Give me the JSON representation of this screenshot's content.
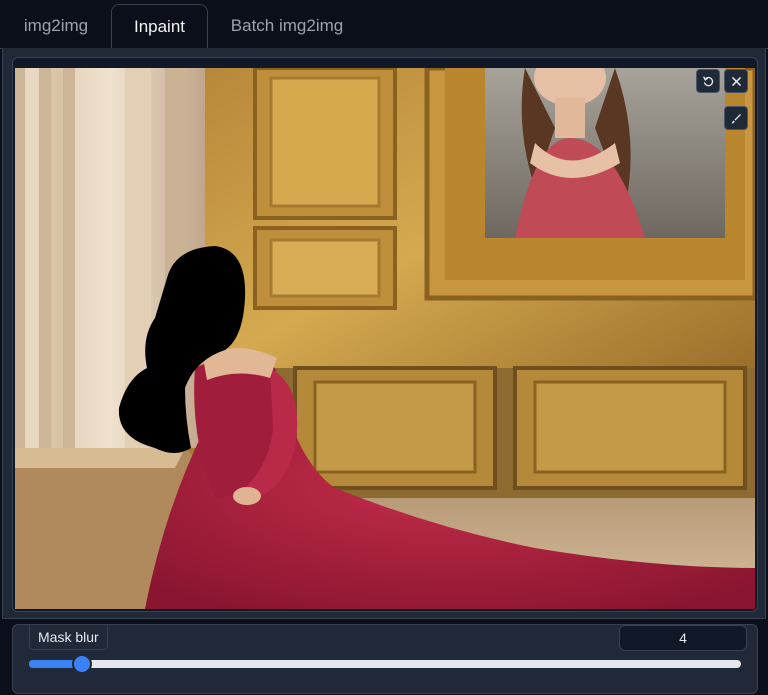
{
  "tabs": [
    {
      "label": "img2img",
      "active": false
    },
    {
      "label": "Inpaint",
      "active": true
    },
    {
      "label": "Batch img2img",
      "active": false
    }
  ],
  "canvas": {
    "icons": [
      "undo-icon",
      "close-icon",
      "brush-icon"
    ]
  },
  "mask_blur": {
    "label": "Mask blur",
    "value": "4",
    "min": 0,
    "max": 64,
    "fill_fraction": 0.074
  },
  "colors": {
    "background": "#0b0f19",
    "panel": "#1f2937",
    "border": "#374151",
    "accent": "#3b82f6",
    "dress": "#b3223f",
    "gold": "#c9a14a",
    "mask": "#000000"
  }
}
